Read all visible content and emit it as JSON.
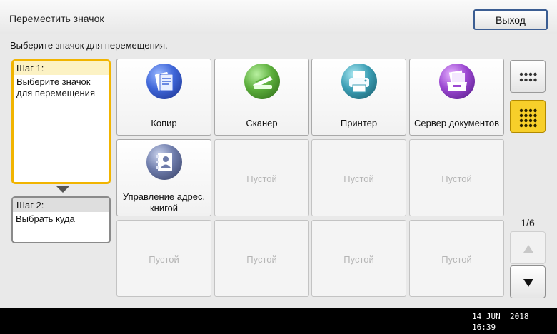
{
  "header": {
    "title": "Переместить значок",
    "exit_label": "Выход"
  },
  "instruction": "Выберите значок для перемещения.",
  "steps": [
    {
      "label": "Шаг 1:",
      "text": "Выберите значок\nдля перемещения",
      "active": true
    },
    {
      "label": "Шаг 2:",
      "text": "Выбрать куда",
      "active": false
    }
  ],
  "tiles": [
    {
      "label": "Копир",
      "icon": "copier-icon"
    },
    {
      "label": "Сканер",
      "icon": "scanner-icon"
    },
    {
      "label": "Принтер",
      "icon": "printer-icon"
    },
    {
      "label": "Сервер документов",
      "icon": "document-server-icon"
    },
    {
      "label": "Управление адрес.\nкнигой",
      "icon": "address-book-icon"
    },
    {
      "label": "Пустой"
    },
    {
      "label": "Пустой"
    },
    {
      "label": "Пустой"
    },
    {
      "label": "Пустой"
    },
    {
      "label": "Пустой"
    },
    {
      "label": "Пустой"
    },
    {
      "label": "Пустой"
    }
  ],
  "pagination": {
    "current": "1/6"
  },
  "status": {
    "date": "14 JUN  2018",
    "time": "16:39"
  },
  "colors": {
    "accent": "#f7cf2a",
    "step_border": "#f1b400",
    "exit_border": "#3b5d92"
  }
}
